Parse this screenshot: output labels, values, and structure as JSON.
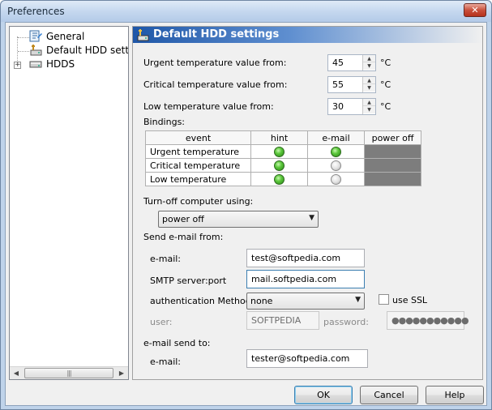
{
  "window": {
    "title": "Preferences",
    "close_glyph": "✕"
  },
  "tree": {
    "items": [
      {
        "label": "General",
        "icon": "general-icon"
      },
      {
        "label": "Default HDD settin",
        "icon": "hdd-settings-icon"
      },
      {
        "label": "HDDS",
        "icon": "hdd-icon"
      }
    ],
    "expander": "+",
    "scroll_thumb": "|||"
  },
  "panel": {
    "title": "Default HDD settings",
    "urgent_label": "Urgent temperature value from:",
    "urgent_value": "45",
    "critical_label": "Critical temperature value from:",
    "critical_value": "55",
    "low_label": "Low temperature value from:",
    "low_value": "30",
    "unit": "°C",
    "bindings_label": "Bindings:",
    "bindings": {
      "headers": [
        "event",
        "hint",
        "e-mail",
        "power off"
      ],
      "rows": [
        {
          "event": "Urgent temperature",
          "hint": true,
          "email": true
        },
        {
          "event": "Critical temperature",
          "hint": true,
          "email": false
        },
        {
          "event": "Low temperature",
          "hint": true,
          "email": false
        }
      ]
    },
    "turnoff_label": "Turn-off computer using:",
    "turnoff_value": "power off",
    "send_from_label": "Send e-mail from:",
    "email_label": "e-mail:",
    "email_value": "test@softpedia.com",
    "smtp_label": "SMTP server:port",
    "smtp_value": "mail.softpedia.com",
    "auth_label": "authentication Method:",
    "auth_value": "none",
    "use_ssl_label": "use SSL",
    "user_label": "user:",
    "user_value": "SOFTPEDIA",
    "password_label": "password:",
    "password_value": "●●●●●●●●●●●",
    "send_to_label": "e-mail send to:",
    "to_email_label": "e-mail:",
    "to_email_value": "tester@softpedia.com"
  },
  "buttons": {
    "ok": "OK",
    "cancel": "Cancel",
    "help": "Help"
  },
  "colors": {
    "header_blue": "#1f57a8",
    "led_green": "#5cc83c",
    "power_off_cell": "#7d7d7d"
  }
}
